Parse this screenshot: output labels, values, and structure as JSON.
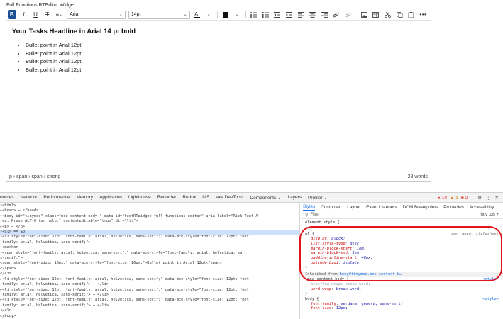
{
  "widget_title": "Full Functions RTEditor Widget",
  "toolbar": {
    "bold": "B",
    "italic": "I",
    "underline": "U",
    "strike": "T",
    "align": "≡",
    "font_family": "Arial",
    "font_size": "14pt"
  },
  "content": {
    "headline": "Your Tasks Headline in Arial 14 pt bold",
    "bullets": [
      "Bullet point in Arial 12pt",
      "Bullet point in Arial 12pt",
      "Bullet point in Arial 12pt",
      "Bullet point in Arial 12pt"
    ]
  },
  "statusbar": {
    "path": "p › span › span › strong",
    "word_count": "28 words"
  },
  "devtools": {
    "tabs": [
      "ources",
      "Network",
      "Performance",
      "Memory",
      "Application",
      "Lighthouse",
      "Recorder",
      "Redux",
      "UI5",
      "axe DevTools",
      "Components ⌄",
      "Layers",
      "Profiler ⌄"
    ],
    "errors": "10",
    "warnings": "1",
    "issues": "2",
    "elements_lines": [
      "▾<html>",
      "  ▸<head> ⋯ </head>",
      "  ▾<body id=\"tinymce\" class=\"mce-content-body \" data-id=\"testRTWidget_full_functions_editor\" aria-label=\"Rich Text A",
      "   rea. Press ALT-0 for help.\" contenteditable=\"true\" dir=\"ltr\">",
      "    ▸<p> ⋯ </p>",
      "    ▾<ul> == $0",
      "      ▾<li style=\"font-size: 12pt; font-family: arial, helvetica, sans-serif;\" data-mce-style=\"font-size: 12pt; font",
      "        -family: arial, helvetica, sans-serif;\">",
      "          ::marker",
      "        ▾<span style=\"font-family: arial, helvetica, sans-serif;\" data-mce-style=\"font-family: arial, helvetica, sa",
      "          s-serif;\">",
      "            <span style=\"font-size: 16px;\" data-mce-style=\"font-size: 16px;\">Bullet point in Arial 12pt</span>",
      "          </span>",
      "        </li>",
      "      ▸<li style=\"font-size: 12pt; font-family: arial, helvetica, sans-serif;\" data-mce-style=\"font-size: 12pt; font",
      "        -family: arial, helvetica, sans-serif;\"> ⋯ </li>",
      "      ▸<li style=\"font-size: 12pt; font-family: arial, helvetica, sans-serif;\" data-mce-style=\"font-size: 12pt; font",
      "        -family: arial, helvetica, sans-serif;\"> ⋯ </li>",
      "      ▸<li style=\"font-size: 12pt; font-family: arial, helvetica, sans-serif;\" data-mce-style=\"font-size: 12pt; font",
      "        -family: arial, helvetica, sans-serif;\"> ⋯ </li>",
      "      </ul>",
      "  </body>"
    ],
    "styles_tabs": [
      "Styles",
      "Computed",
      "Layout",
      "Event Listeners",
      "DOM Breakpoints",
      "Properties",
      "Accessibility"
    ],
    "filter_placeholder": "Filter",
    "filter_controls": ":hov .cls  +",
    "element_style": "element.style {",
    "close_brace": "}",
    "ul_rule": {
      "selector": "ul {",
      "source": "user agent stylesheet",
      "props": [
        {
          "name": "display",
          "value": "block;"
        },
        {
          "name": "list-style-type",
          "value": "disc;"
        },
        {
          "name": "margin-block-start",
          "value": "1em;"
        },
        {
          "name": "margin-block-end",
          "value": "1em;"
        },
        {
          "name": "padding-inline-start",
          "value": "40px;"
        },
        {
          "name": "unicode-bidi",
          "value": "isolate;"
        }
      ]
    },
    "inherited_label": "Inherited from",
    "inherited_from": "body#tinymce.mce-content-b…",
    "mce_rule": {
      "selector": ".mce-content-body {",
      "source": "<style>",
      "props": [
        {
          "name": "overflow-wrap",
          "value": "break-word;"
        },
        {
          "name": "word-wrap",
          "value": "break-word;"
        }
      ]
    },
    "body_rule": {
      "selector": "body {",
      "source": "<style>",
      "props": [
        {
          "name": "font-family",
          "value": "verdana, geneva, sans-serif;"
        },
        {
          "name": "font-size",
          "value": "12px;"
        }
      ]
    }
  },
  "colors": {
    "bold_button": "#1b4f93",
    "annotation_oval": "#e0151c",
    "active_tab": "#1a73e8"
  }
}
